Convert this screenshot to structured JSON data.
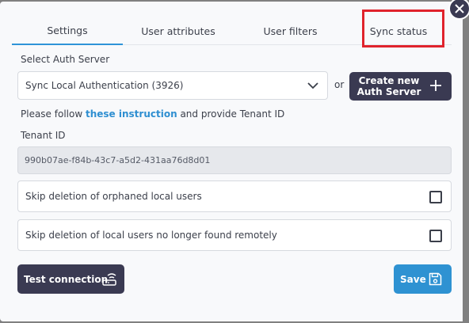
{
  "tabs": [
    {
      "label": "Settings",
      "active": true
    },
    {
      "label": "User attributes",
      "active": false
    },
    {
      "label": "User filters",
      "active": false
    },
    {
      "label": "Sync status",
      "active": false
    }
  ],
  "auth_server": {
    "label": "Select Auth Server",
    "selected": "Sync Local Authentication (3926)",
    "or_text": "or",
    "create_line1": "Create new",
    "create_line2": "Auth Server"
  },
  "instructions": {
    "prefix": "Please follow",
    "link": "these instruction",
    "suffix": "and provide Tenant ID"
  },
  "tenant": {
    "label": "Tenant ID",
    "value": "990b07ae-f84b-43c7-a5d2-431aa76d8d01"
  },
  "options": [
    {
      "label": "Skip deletion of orphaned local users",
      "checked": false
    },
    {
      "label": "Skip deletion of local users no longer found remotely",
      "checked": false
    }
  ],
  "buttons": {
    "test": "Test connection",
    "save": "Save"
  },
  "colors": {
    "accent": "#2f94d8",
    "dark": "#3a3a52",
    "highlight": "#e0232c"
  }
}
